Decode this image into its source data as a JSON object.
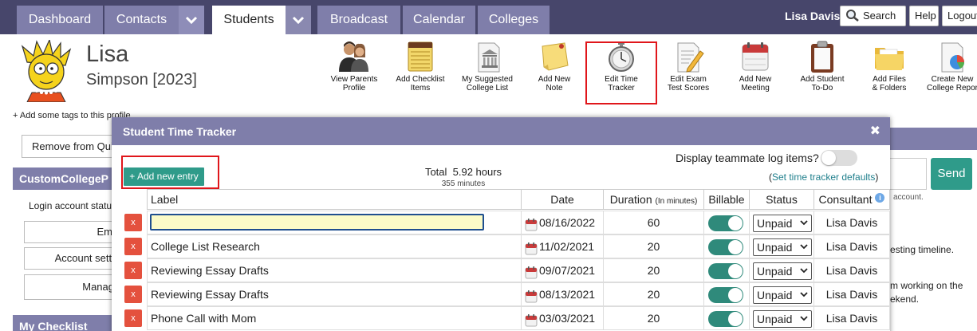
{
  "nav": {
    "tabs": [
      {
        "label": "Dashboard"
      },
      {
        "label": "Contacts"
      },
      {
        "label": "Students"
      },
      {
        "label": "Broadcast"
      },
      {
        "label": "Calendar"
      },
      {
        "label": "Colleges"
      }
    ],
    "user_name": "Lisa Davis",
    "search_label": "Search",
    "help_label": "Help",
    "logout_label": "Logout"
  },
  "profile": {
    "first_name": "Lisa",
    "last_name_year": "Simpson [2023]"
  },
  "toolbar": {
    "items": [
      {
        "label": "View Parents\nProfile",
        "icon": "parents-icon"
      },
      {
        "label": "Add Checklist\nItems",
        "icon": "checklist-icon"
      },
      {
        "label": "My Suggested\nCollege List",
        "icon": "college-list-icon"
      },
      {
        "label": "Add New\nNote",
        "icon": "note-icon"
      },
      {
        "label": "Edit Time\nTracker",
        "icon": "stopwatch-icon"
      },
      {
        "label": "Edit Exam\nTest Scores",
        "icon": "test-scores-icon"
      },
      {
        "label": "Add New\nMeeting",
        "icon": "calendar-icon"
      },
      {
        "label": "Add Student\nTo-Do",
        "icon": "clipboard-icon"
      },
      {
        "label": "Add Files\n& Folders",
        "icon": "folder-icon"
      },
      {
        "label": "Create New\nCollege Repor",
        "icon": "report-icon"
      }
    ]
  },
  "background": {
    "tags_link": "+ Add some tags to this profile",
    "remove_button": "Remove from Qui",
    "side_header_1": "CustomCollegeP",
    "login_status": "Login account statu",
    "side_btn_1": "Em",
    "side_btn_2": "Account setti",
    "side_btn_3": "Manag",
    "side_header_2": "My Checklist",
    "send_label": "Send",
    "right_note_1": "account.",
    "right_note_2": "esting timeline.",
    "right_note_3": "m working on the",
    "right_note_4": "ekend."
  },
  "modal": {
    "title": "Student Time Tracker",
    "close_glyph": "✖",
    "add_entry_label": "+ Add new entry",
    "total_label": "Total  5.92 hours",
    "total_minutes": "355 minutes",
    "teammate_label": "Display teammate log items?",
    "defaults_prefix": "(",
    "defaults_link": "Set time tracker defaults",
    "defaults_suffix": ")",
    "columns": {
      "label": "Label",
      "date": "Date",
      "duration": "Duration",
      "duration_unit": "(In minutes)",
      "billable": "Billable",
      "status": "Status",
      "consultant": "Consultant"
    },
    "rows": [
      {
        "label": "",
        "date": "08/16/2022",
        "duration": "60",
        "billable": true,
        "status": "Unpaid",
        "consultant": "Lisa Davis"
      },
      {
        "label": "College List Research",
        "date": "11/02/2021",
        "duration": "20",
        "billable": true,
        "status": "Unpaid",
        "consultant": "Lisa Davis"
      },
      {
        "label": "Reviewing Essay Drafts",
        "date": "09/07/2021",
        "duration": "20",
        "billable": true,
        "status": "Unpaid",
        "consultant": "Lisa Davis"
      },
      {
        "label": "Reviewing Essay Drafts",
        "date": "08/13/2021",
        "duration": "20",
        "billable": true,
        "status": "Unpaid",
        "consultant": "Lisa Davis"
      },
      {
        "label": "Phone Call with Mom",
        "date": "03/03/2021",
        "duration": "20",
        "billable": true,
        "status": "Unpaid",
        "consultant": "Lisa Davis"
      }
    ],
    "delete_glyph": "x"
  },
  "colors": {
    "nav_bg": "#47466b",
    "tab_bg": "#7f7eaa",
    "accent_teal": "#2f9b8a",
    "delete_red": "#e4513e",
    "highlight_red": "#e0161b"
  }
}
